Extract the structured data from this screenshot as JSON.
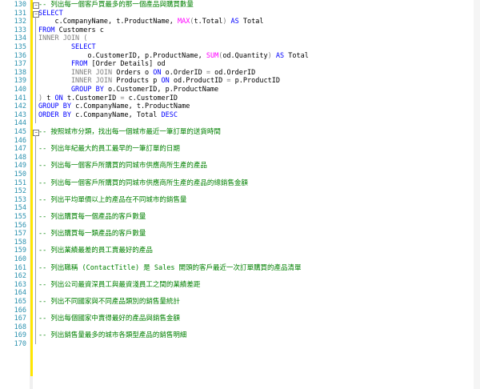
{
  "editor": {
    "lines": [
      {
        "num": "130",
        "tokens": [
          {
            "t": "-- 列出每一個客戶買最多的那一個產品與購買數量",
            "c": "cm"
          }
        ],
        "fold": "minus"
      },
      {
        "num": "131",
        "tokens": [
          {
            "t": "SELECT",
            "c": "kw"
          }
        ],
        "fold": "minus"
      },
      {
        "num": "132",
        "tokens": [
          {
            "t": "    c.CompanyName, t.ProductName, ",
            "c": ""
          },
          {
            "t": "MAX",
            "c": "fn"
          },
          {
            "t": "(",
            "c": "op"
          },
          {
            "t": "t.Total",
            "c": ""
          },
          {
            "t": ")",
            "c": "op"
          },
          {
            "t": " AS ",
            "c": "kw"
          },
          {
            "t": "Total",
            "c": ""
          }
        ]
      },
      {
        "num": "133",
        "tokens": [
          {
            "t": "FROM ",
            "c": "kw"
          },
          {
            "t": "Customers c",
            "c": ""
          }
        ]
      },
      {
        "num": "134",
        "tokens": [
          {
            "t": "INNER JOIN ",
            "c": "op"
          },
          {
            "t": "(",
            "c": "op"
          }
        ]
      },
      {
        "num": "135",
        "tokens": [
          {
            "t": "        SELECT",
            "c": "kw"
          }
        ]
      },
      {
        "num": "136",
        "tokens": [
          {
            "t": "            o.CustomerID, p.ProductName, ",
            "c": ""
          },
          {
            "t": "SUM",
            "c": "fn"
          },
          {
            "t": "(",
            "c": "op"
          },
          {
            "t": "od.Quantity",
            "c": ""
          },
          {
            "t": ")",
            "c": "op"
          },
          {
            "t": " AS ",
            "c": "kw"
          },
          {
            "t": "Total",
            "c": ""
          }
        ]
      },
      {
        "num": "137",
        "tokens": [
          {
            "t": "        FROM ",
            "c": "kw"
          },
          {
            "t": "[Order Details] od",
            "c": ""
          }
        ]
      },
      {
        "num": "138",
        "tokens": [
          {
            "t": "        INNER JOIN ",
            "c": "op"
          },
          {
            "t": "Orders o ",
            "c": ""
          },
          {
            "t": "ON ",
            "c": "kw"
          },
          {
            "t": "o.OrderID ",
            "c": ""
          },
          {
            "t": "= ",
            "c": "op"
          },
          {
            "t": "od.OrderID",
            "c": ""
          }
        ]
      },
      {
        "num": "139",
        "tokens": [
          {
            "t": "        INNER JOIN ",
            "c": "op"
          },
          {
            "t": "Products p ",
            "c": ""
          },
          {
            "t": "ON ",
            "c": "kw"
          },
          {
            "t": "od.ProductID ",
            "c": ""
          },
          {
            "t": "= ",
            "c": "op"
          },
          {
            "t": "p.ProductID",
            "c": ""
          }
        ]
      },
      {
        "num": "140",
        "tokens": [
          {
            "t": "        GROUP BY ",
            "c": "kw"
          },
          {
            "t": "o.CustomerID, p.ProductName",
            "c": ""
          }
        ]
      },
      {
        "num": "141",
        "tokens": [
          {
            "t": ") ",
            "c": "op"
          },
          {
            "t": "t ",
            "c": ""
          },
          {
            "t": "ON ",
            "c": "kw"
          },
          {
            "t": "t.CustomerID ",
            "c": ""
          },
          {
            "t": "= ",
            "c": "op"
          },
          {
            "t": "c.CustomerID",
            "c": ""
          }
        ]
      },
      {
        "num": "142",
        "tokens": [
          {
            "t": "GROUP BY ",
            "c": "kw"
          },
          {
            "t": "c.CompanyName, t.ProductName",
            "c": ""
          }
        ]
      },
      {
        "num": "143",
        "tokens": [
          {
            "t": "ORDER BY ",
            "c": "kw"
          },
          {
            "t": "c.CompanyName, Total ",
            "c": ""
          },
          {
            "t": "DESC",
            "c": "kw"
          }
        ]
      },
      {
        "num": "144",
        "tokens": []
      },
      {
        "num": "145",
        "tokens": [
          {
            "t": "-- 按照城市分類，找出每一個城市最近一筆訂單的送貨時間",
            "c": "cm"
          }
        ],
        "fold": "minus"
      },
      {
        "num": "146",
        "tokens": []
      },
      {
        "num": "147",
        "tokens": [
          {
            "t": "-- 列出年紀最大的員工最早的一筆訂單的日期",
            "c": "cm"
          }
        ]
      },
      {
        "num": "148",
        "tokens": []
      },
      {
        "num": "149",
        "tokens": [
          {
            "t": "-- 列出每一個客戶所購買的同城市供應商所生產的產品",
            "c": "cm"
          }
        ]
      },
      {
        "num": "150",
        "tokens": []
      },
      {
        "num": "151",
        "tokens": [
          {
            "t": "-- 列出每一個客戶所購買的同城市供應商所生產的產品的總銷售金額",
            "c": "cm"
          }
        ]
      },
      {
        "num": "152",
        "tokens": []
      },
      {
        "num": "153",
        "tokens": [
          {
            "t": "-- 列出平均單價以上的產品在不同城市的銷售量",
            "c": "cm"
          }
        ]
      },
      {
        "num": "154",
        "tokens": []
      },
      {
        "num": "155",
        "tokens": [
          {
            "t": "-- 列出購買每一個產品的客戶數量",
            "c": "cm"
          }
        ]
      },
      {
        "num": "156",
        "tokens": []
      },
      {
        "num": "157",
        "tokens": [
          {
            "t": "-- 列出購買每一類產品的客戶數量",
            "c": "cm"
          }
        ]
      },
      {
        "num": "158",
        "tokens": []
      },
      {
        "num": "159",
        "tokens": [
          {
            "t": "-- 列出業績最差的員工賣最好的產品",
            "c": "cm"
          }
        ]
      },
      {
        "num": "160",
        "tokens": []
      },
      {
        "num": "161",
        "tokens": [
          {
            "t": "-- 列出職稱 (ContactTitle) 是 Sales 開頭的客戶最近一次訂單購買的產品清單",
            "c": "cm"
          }
        ]
      },
      {
        "num": "162",
        "tokens": []
      },
      {
        "num": "163",
        "tokens": [
          {
            "t": "-- 列出公司最資深員工與最資淺員工之間的業績差距",
            "c": "cm"
          }
        ]
      },
      {
        "num": "164",
        "tokens": []
      },
      {
        "num": "165",
        "tokens": [
          {
            "t": "-- 列出不同國家與不同產品類別的銷售量統計",
            "c": "cm"
          }
        ]
      },
      {
        "num": "166",
        "tokens": []
      },
      {
        "num": "167",
        "tokens": [
          {
            "t": "-- 列出每個國家中賣得最好的產品與銷售金額",
            "c": "cm"
          }
        ]
      },
      {
        "num": "168",
        "tokens": []
      },
      {
        "num": "169",
        "tokens": [
          {
            "t": "-- 列出銷售量最多的城市各類型產品的銷售明細",
            "c": "cm"
          }
        ]
      },
      {
        "num": "170",
        "tokens": []
      }
    ]
  }
}
